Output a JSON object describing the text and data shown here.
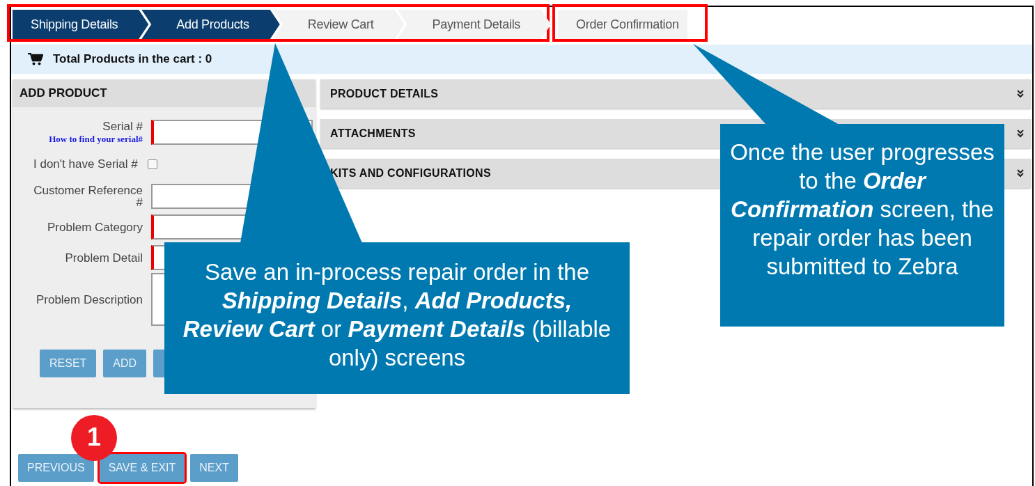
{
  "step_groups": [
    {
      "highlighted": true,
      "steps": [
        {
          "label": "Shipping Details",
          "completed": true
        },
        {
          "label": "Add Products",
          "completed": true
        },
        {
          "label": "Review Cart",
          "completed": false
        },
        {
          "label": "Payment Details",
          "completed": false
        }
      ]
    },
    {
      "highlighted": true,
      "steps": [
        {
          "label": "Order Confirmation",
          "completed": false
        }
      ]
    }
  ],
  "cart_summary": "Total Products in the cart : 0",
  "add_product": {
    "title": "ADD PRODUCT",
    "fields": [
      {
        "kind": "input",
        "label": "Serial #",
        "help_link": "How to find your serial#",
        "required": true
      },
      {
        "kind": "checkbox",
        "label": "I don't have Serial #",
        "checked": false
      },
      {
        "kind": "input",
        "label": "Customer Reference #",
        "required": false
      },
      {
        "kind": "input",
        "label": "Problem Category",
        "required": true
      },
      {
        "kind": "input",
        "label": "Problem Detail",
        "required": true
      },
      {
        "kind": "textarea",
        "label": "Problem Description",
        "required": false
      }
    ],
    "buttons": [
      {
        "kind": "labeled",
        "label": "RESET"
      },
      {
        "kind": "labeled",
        "label": "ADD"
      },
      {
        "kind": "obscured"
      }
    ]
  },
  "sections": [
    {
      "title": "PRODUCT DETAILS",
      "expanded": false
    },
    {
      "title": "ATTACHMENTS",
      "expanded": false
    },
    {
      "title": "KITS AND CONFIGURATIONS",
      "expanded": false
    }
  ],
  "nav_buttons": [
    {
      "label": "PREVIOUS",
      "highlighted": false
    },
    {
      "label": "SAVE & EXIT",
      "highlighted": true
    },
    {
      "label": "NEXT",
      "highlighted": false
    }
  ],
  "step_badge": "1",
  "callouts": [
    {
      "text": "Save an in-process repair order in the **Shipping Details**, **Add Products, Review Cart** or **Payment Details** (billable only) screens"
    },
    {
      "text": "Once the user progresses to the **Order Confirmation** screen, the repair order has been submitted to Zebra"
    }
  ]
}
